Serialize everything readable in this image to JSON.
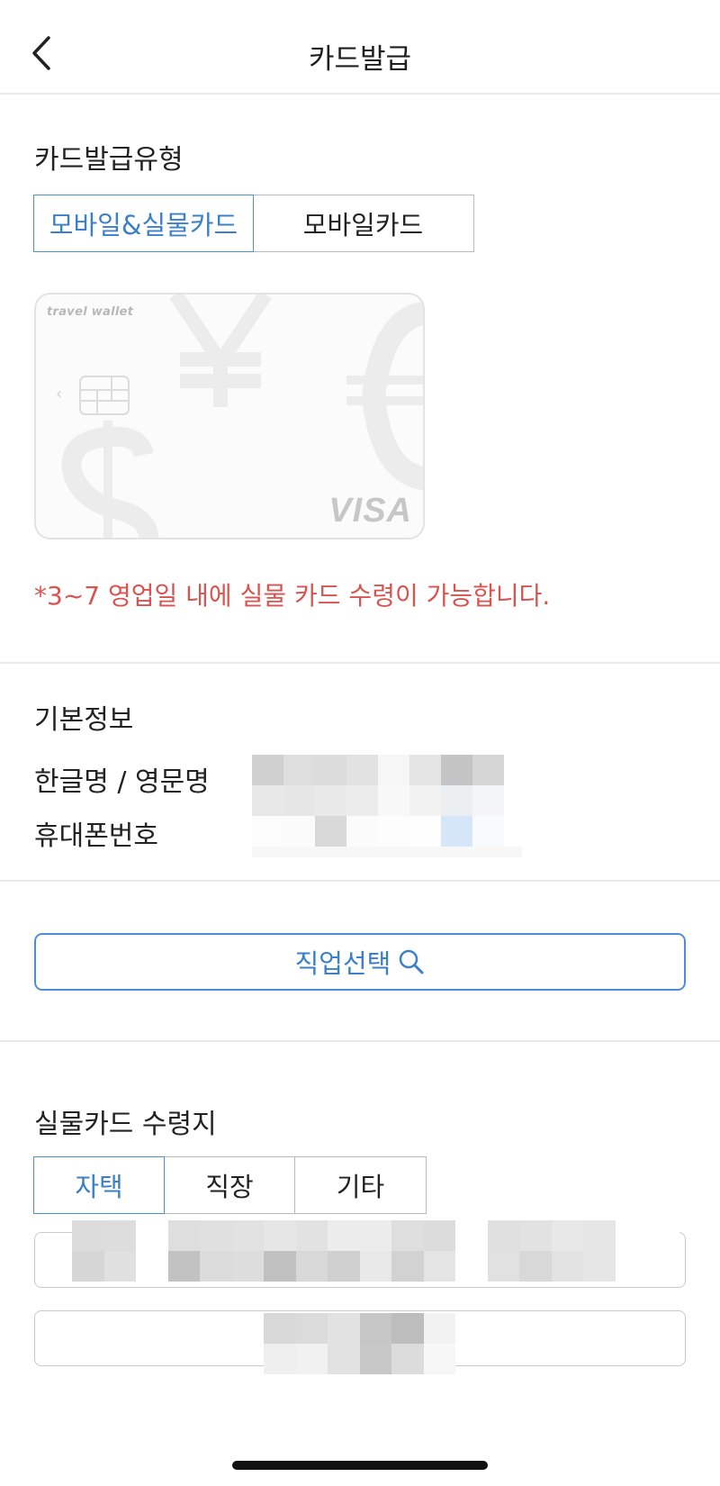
{
  "header": {
    "title": "카드발급"
  },
  "issue_type": {
    "label": "카드발급유형",
    "options": [
      {
        "label": "모바일&실물카드",
        "selected": true
      },
      {
        "label": "모바일카드",
        "selected": false
      }
    ]
  },
  "card": {
    "brand": "travel wallet",
    "network": "VISA"
  },
  "notice": "*3~7 영업일 내에 실물 카드 수령이 가능합니다.",
  "basic_info": {
    "label": "기본정보",
    "name_label": "한글명 / 영문명",
    "phone_label": "휴대폰번호"
  },
  "job": {
    "button_label": "직업선택"
  },
  "delivery": {
    "label": "실물카드 수령지",
    "options": [
      {
        "label": "자택",
        "selected": true
      },
      {
        "label": "직장",
        "selected": false
      },
      {
        "label": "기타",
        "selected": false
      }
    ]
  },
  "colors": {
    "accent": "#3b80c9",
    "warning": "#d9534f",
    "border": "#b9b9b9"
  }
}
